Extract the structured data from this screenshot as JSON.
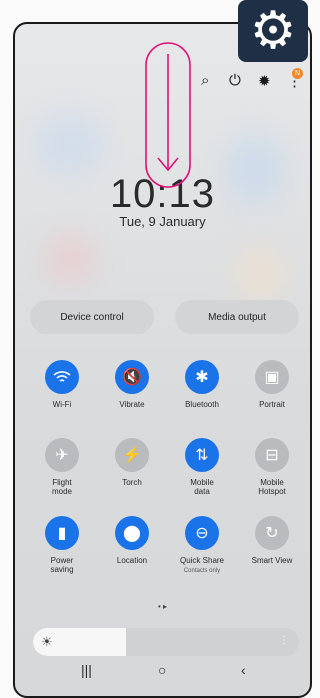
{
  "status": {
    "icons": [
      "alarm-icon",
      "bluetooth-icon",
      "mute-icon"
    ]
  },
  "top_controls": {
    "badge_count": "N"
  },
  "clock": {
    "time": "10:13",
    "date": "Tue, 9 January"
  },
  "buttons": {
    "device_control": "Device control",
    "media_output": "Media output"
  },
  "tiles": [
    {
      "label": "Wi-Fi",
      "icon": "wifi-icon",
      "state": "on"
    },
    {
      "label": "Vibrate",
      "icon": "vibrate-icon",
      "state": "on"
    },
    {
      "label": "Bluetooth",
      "icon": "bluetooth-icon",
      "state": "on"
    },
    {
      "label": "Portrait",
      "icon": "portrait-icon",
      "state": "off"
    },
    {
      "label": "Flight\nmode",
      "icon": "airplane-icon",
      "state": "off"
    },
    {
      "label": "Torch",
      "icon": "torch-icon",
      "state": "off"
    },
    {
      "label": "Mobile\ndata",
      "icon": "mobile-data-icon",
      "state": "on"
    },
    {
      "label": "Mobile\nHotspot",
      "icon": "hotspot-icon",
      "state": "off"
    },
    {
      "label": "Power\nsaving",
      "icon": "battery-saver-icon",
      "state": "on"
    },
    {
      "label": "Location",
      "icon": "location-icon",
      "state": "on"
    },
    {
      "label": "Quick Share",
      "sub": "Contacts only",
      "icon": "quick-share-icon",
      "state": "on"
    },
    {
      "label": "Smart View",
      "icon": "smart-view-icon",
      "state": "off"
    }
  ],
  "brightness": {
    "level": 0.35
  },
  "colors": {
    "accent": "#1a73e8",
    "badge": "#f08a2a",
    "annotation": "#e0147a"
  }
}
